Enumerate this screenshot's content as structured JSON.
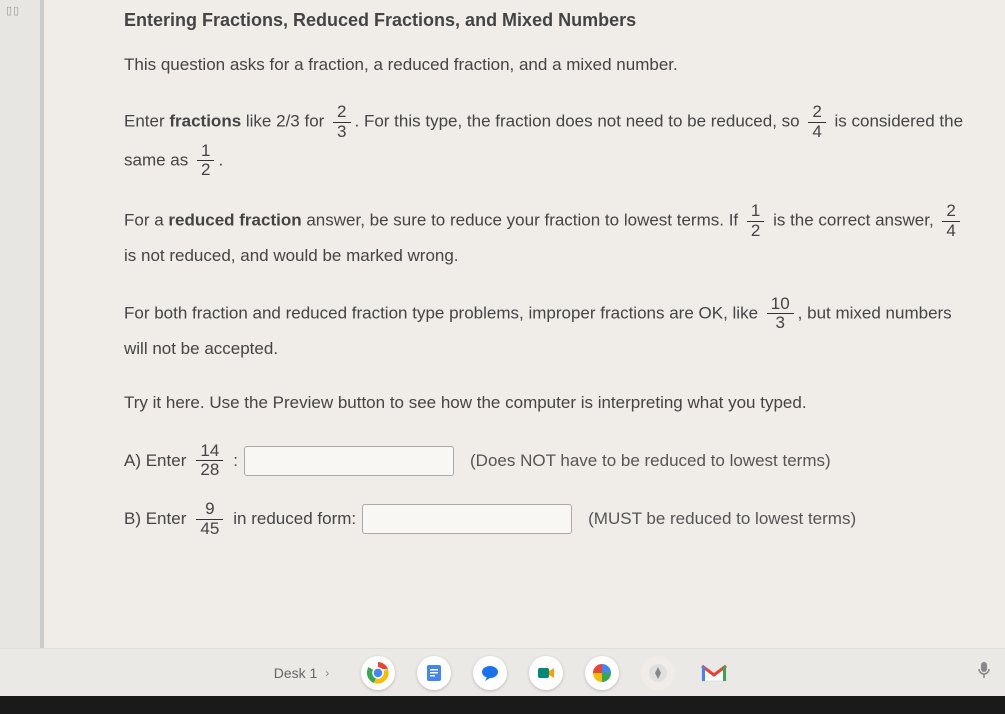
{
  "heading": "Entering Fractions, Reduced Fractions, and Mixed Numbers",
  "intro": "This question asks for a fraction, a reduced fraction, and a mixed number.",
  "p1": {
    "t1": "Enter ",
    "bold1": "fractions",
    "t2": " like 2/3 for ",
    "f1n": "2",
    "f1d": "3",
    "t3": ". For this type, the fraction does not need to be reduced, so ",
    "f2n": "2",
    "f2d": "4",
    "t4": " is considered the same as ",
    "f3n": "1",
    "f3d": "2",
    "t5": "."
  },
  "p2": {
    "t1": "For a ",
    "bold1": "reduced fraction",
    "t2": " answer, be sure to reduce your fraction to lowest terms. If ",
    "f1n": "1",
    "f1d": "2",
    "t3": " is the correct answer, ",
    "f2n": "2",
    "f2d": "4",
    "t4": " is not reduced, and would be marked wrong."
  },
  "p3": {
    "t1": "For both fraction and reduced fraction type problems, improper fractions are OK, like ",
    "f1n": "10",
    "f1d": "3",
    "t2": ", but mixed numbers will not be accepted."
  },
  "p4": "Try it here. Use the Preview button to see how the computer is interpreting what you typed.",
  "qa": {
    "label1": "A) Enter ",
    "fn": "14",
    "fd": "28",
    "colon": ":",
    "hint": "(Does NOT have to be reduced to lowest terms)"
  },
  "qb": {
    "label1": "B) Enter ",
    "fn": "9",
    "fd": "45",
    "label2": " in reduced form:",
    "hint": "(MUST be reduced to lowest terms)"
  },
  "taskbar": {
    "desk": "Desk 1"
  }
}
